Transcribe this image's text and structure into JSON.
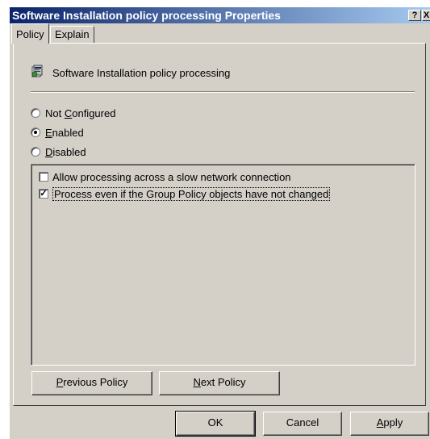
{
  "window": {
    "title": "Software Installation policy processing Properties",
    "help_glyph": "?",
    "close_glyph": "X"
  },
  "tabs": [
    {
      "label": "Policy",
      "active": true
    },
    {
      "label": "Explain",
      "active": false
    }
  ],
  "policy": {
    "name": "Software Installation policy processing",
    "icon": "policy-setting-icon"
  },
  "radios": {
    "not_configured": {
      "pre": "Not ",
      "key": "C",
      "post": "onfigured",
      "checked": false
    },
    "enabled": {
      "pre": "",
      "key": "E",
      "post": "nabled",
      "checked": true
    },
    "disabled": {
      "pre": "",
      "key": "D",
      "post": "isabled",
      "checked": false
    }
  },
  "options": {
    "slow_network": {
      "label": "Allow processing across a slow network connection",
      "checked": false
    },
    "process_unchanged": {
      "label": "Process even if the Group Policy objects have not changed",
      "checked": true
    }
  },
  "nav_buttons": {
    "previous": {
      "key": "P",
      "rest": "revious Policy"
    },
    "next": {
      "key": "N",
      "rest": "ext Policy"
    }
  },
  "dialog_buttons": {
    "ok": "OK",
    "cancel": "Cancel",
    "apply": {
      "key": "A",
      "rest": "pply"
    }
  },
  "check_glyph": "✓",
  "colors": {
    "title_start": "#0a246a",
    "title_end": "#a6caf0",
    "face": "#d4d0c8"
  }
}
